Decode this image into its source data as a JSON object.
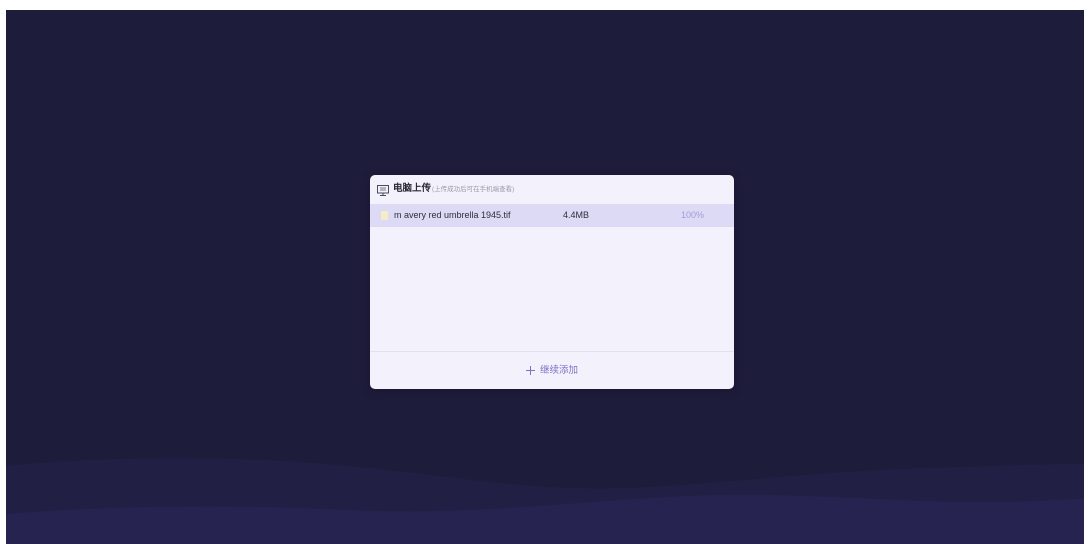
{
  "dialog": {
    "title": "电脑上传",
    "subtitle": "(上传成功后可在手机端查看)",
    "icon": "monitor-icon"
  },
  "files": [
    {
      "name": "m avery red umbrella 1945.tif",
      "size": "4.4MB",
      "progress_text": "100%",
      "progress": 1.0,
      "icon": "file-icon"
    }
  ],
  "footer": {
    "add_more_label": "继续添加",
    "icon": "plus-icon"
  },
  "colors": {
    "background": "#1e1c3b",
    "dialog": "#f3f2fc",
    "row_highlight": "#dcdaf5",
    "accent": "#7c72c8",
    "progress_text": "#a39bdc"
  }
}
